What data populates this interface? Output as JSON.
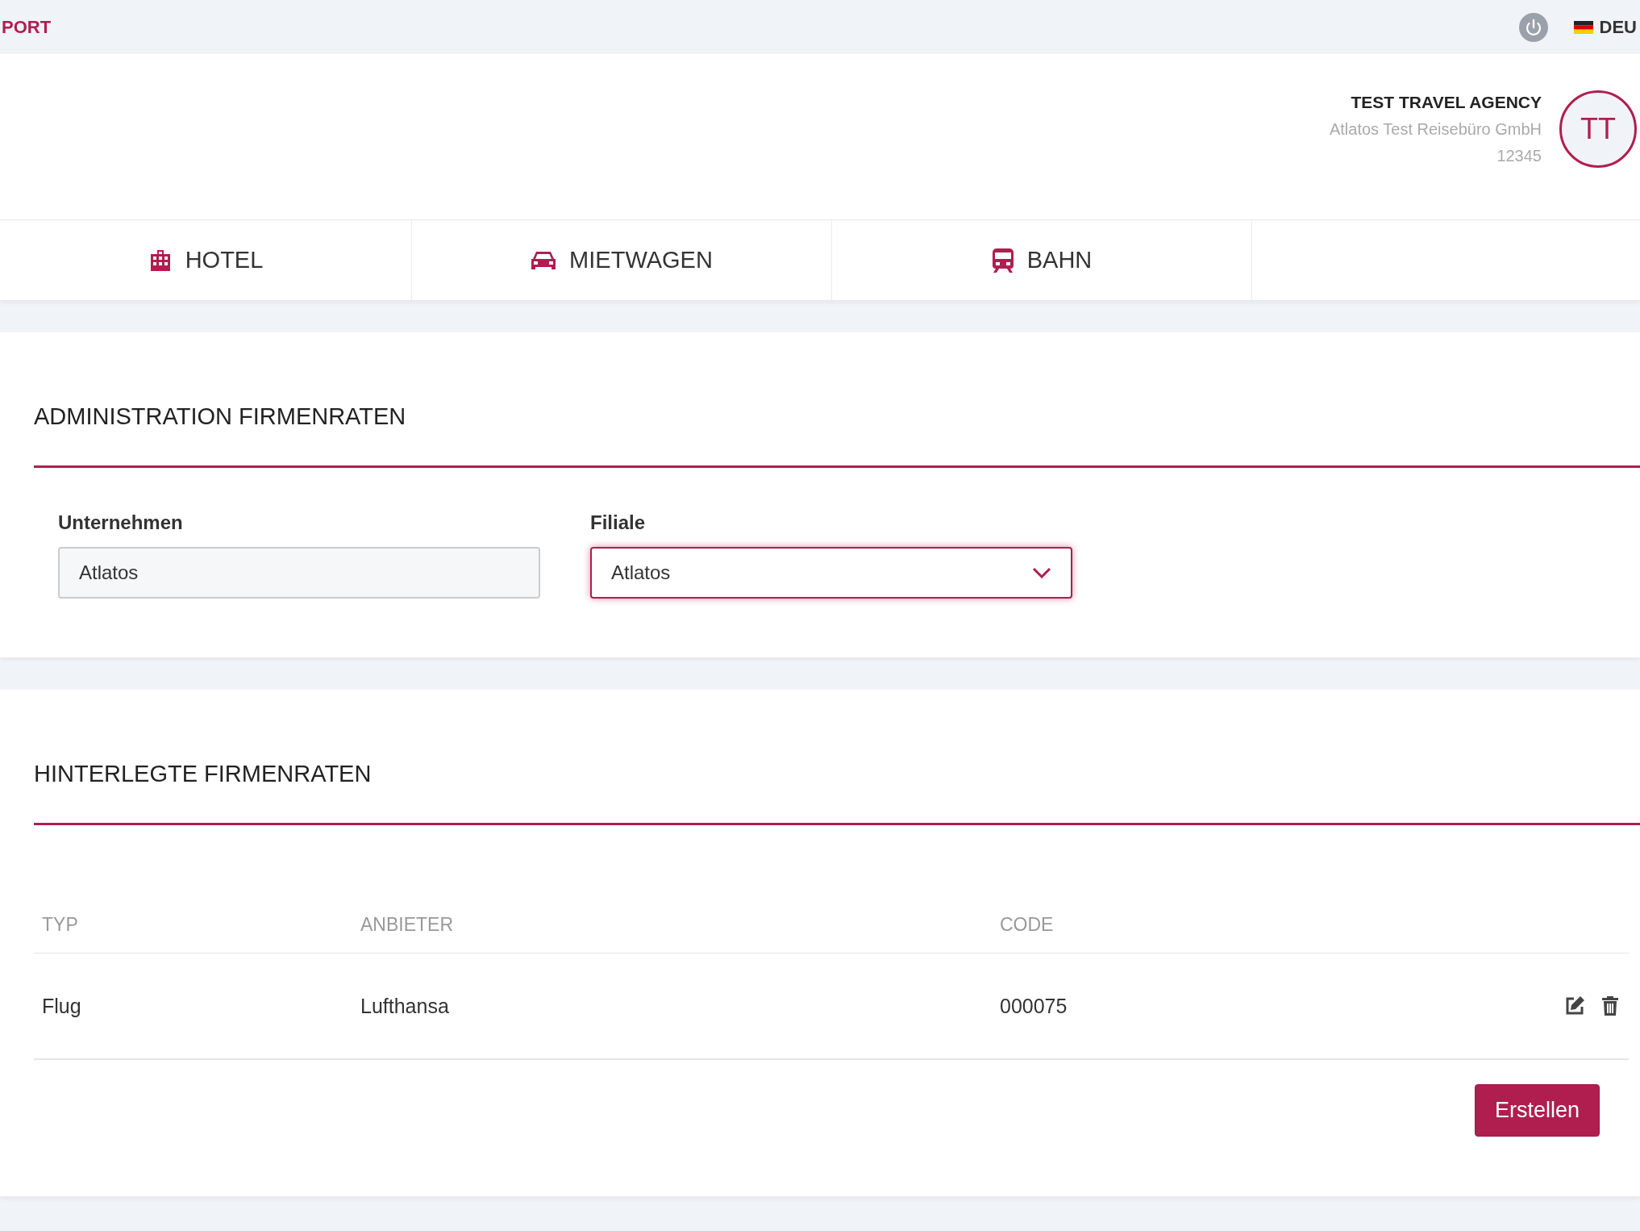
{
  "top_bar": {
    "brand": "PORT",
    "language": "DEU"
  },
  "agency": {
    "name": "TEST TRAVEL AGENCY",
    "company": "Atlatos Test Reisebüro GmbH",
    "number": "12345",
    "initials": "TT"
  },
  "tabs": [
    {
      "kind": "hotel",
      "label": "HOTEL"
    },
    {
      "kind": "car",
      "label": "MIETWAGEN"
    },
    {
      "kind": "train",
      "label": "BAHN"
    }
  ],
  "admin": {
    "title": "ADMINISTRATION FIRMENRATEN",
    "fields": [
      {
        "kind": "text",
        "label": "Unternehmen",
        "value": "Atlatos"
      },
      {
        "kind": "select",
        "label": "Filiale",
        "value": "Atlatos",
        "focused": true
      }
    ]
  },
  "rates": {
    "title": "HINTERLEGTE FIRMENRATEN",
    "columns": [
      "TYP",
      "ANBIETER",
      "CODE"
    ],
    "rows": [
      {
        "cells": [
          "Flug",
          "Lufthansa",
          "000075"
        ]
      }
    ],
    "create_button": "Erstellen"
  }
}
